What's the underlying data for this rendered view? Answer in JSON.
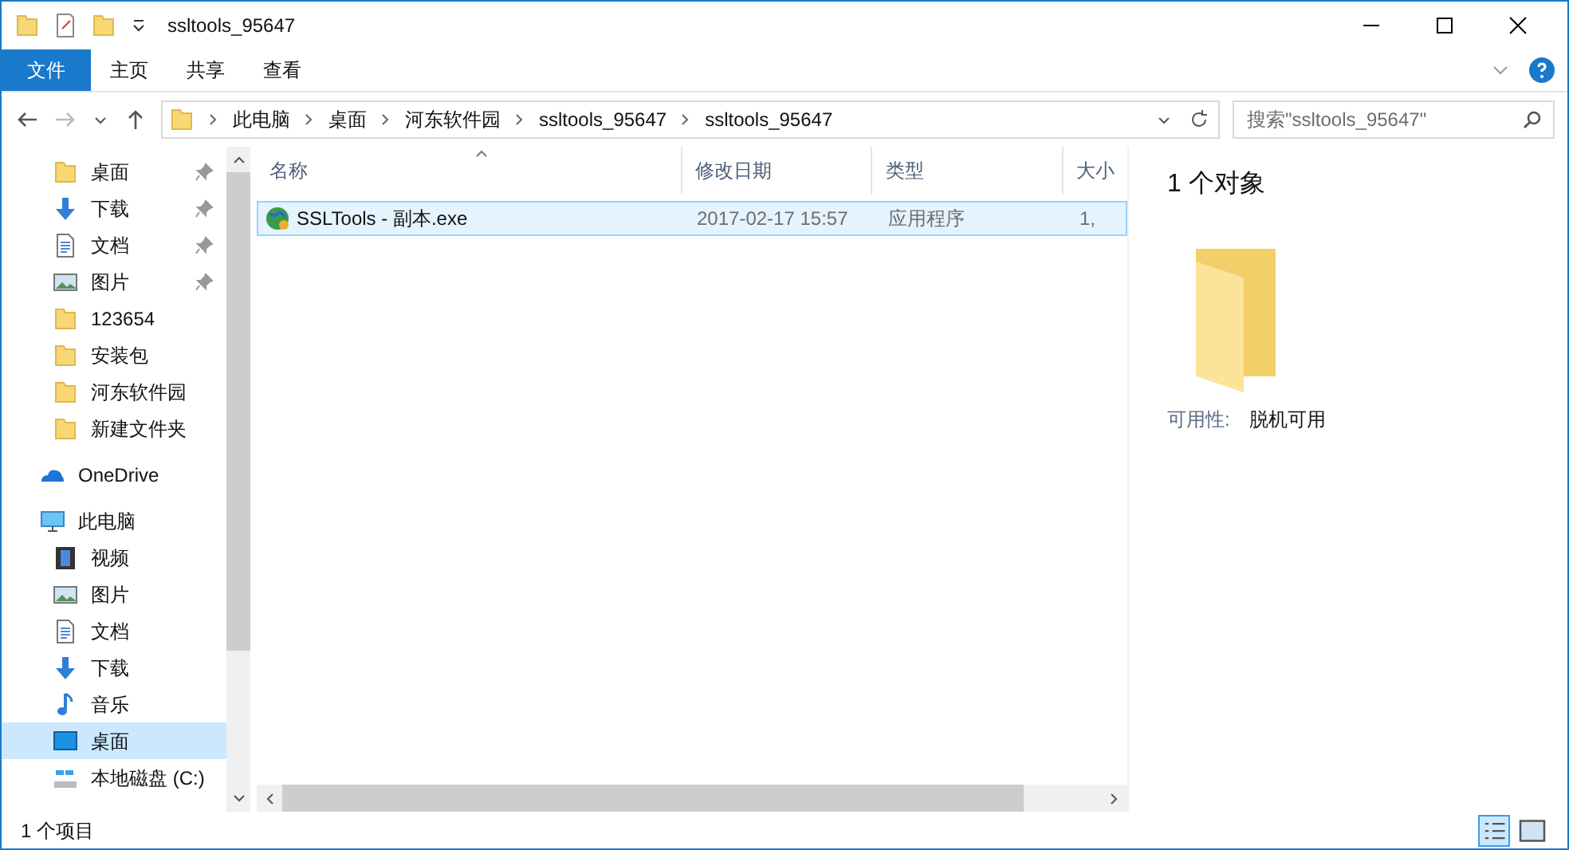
{
  "window": {
    "title": "ssltools_95647"
  },
  "ribbon_tabs": [
    {
      "label": "文件",
      "kind": "file",
      "selected": false
    },
    {
      "label": "主页",
      "kind": "tab",
      "selected": false
    },
    {
      "label": "共享",
      "kind": "tab",
      "selected": false
    },
    {
      "label": "查看",
      "kind": "tab",
      "selected": false
    }
  ],
  "address_bar": {
    "segments": [
      "此电脑",
      "桌面",
      "河东软件园",
      "ssltools_95647",
      "ssltools_95647"
    ]
  },
  "search": {
    "placeholder": "搜索\"ssltools_95647\""
  },
  "sidebar": {
    "quick_access": [
      {
        "label": "桌面",
        "kind": "folder",
        "pinned": true
      },
      {
        "label": "下载",
        "kind": "download",
        "pinned": true
      },
      {
        "label": "文档",
        "kind": "document",
        "pinned": true
      },
      {
        "label": "图片",
        "kind": "picture",
        "pinned": true
      },
      {
        "label": "123654",
        "kind": "folder",
        "pinned": false
      },
      {
        "label": "安装包",
        "kind": "folder",
        "pinned": false
      },
      {
        "label": "河东软件园",
        "kind": "folder",
        "pinned": false
      },
      {
        "label": "新建文件夹",
        "kind": "folder",
        "pinned": false
      }
    ],
    "roots": [
      {
        "label": "OneDrive",
        "kind": "cloud"
      },
      {
        "label": "此电脑",
        "kind": "pc",
        "children": [
          {
            "label": "视频",
            "kind": "video",
            "selected": false
          },
          {
            "label": "图片",
            "kind": "picture",
            "selected": false
          },
          {
            "label": "文档",
            "kind": "document",
            "selected": false
          },
          {
            "label": "下载",
            "kind": "download",
            "selected": false
          },
          {
            "label": "音乐",
            "kind": "music",
            "selected": false
          },
          {
            "label": "桌面",
            "kind": "desktop",
            "selected": true
          },
          {
            "label": "本地磁盘 (C:)",
            "kind": "drive",
            "selected": false
          }
        ]
      }
    ]
  },
  "table": {
    "columns": [
      "名称",
      "修改日期",
      "类型",
      "大小"
    ],
    "rows": [
      {
        "cells": [
          "SSLTools - 副本.exe",
          "2017-02-17 15:57",
          "应用程序",
          "1,"
        ],
        "selected": true
      }
    ]
  },
  "details": {
    "title": "1 个对象",
    "properties": [
      {
        "label": "可用性:",
        "value": "脱机可用"
      }
    ]
  },
  "status_bar": {
    "text": "1 个项目"
  }
}
